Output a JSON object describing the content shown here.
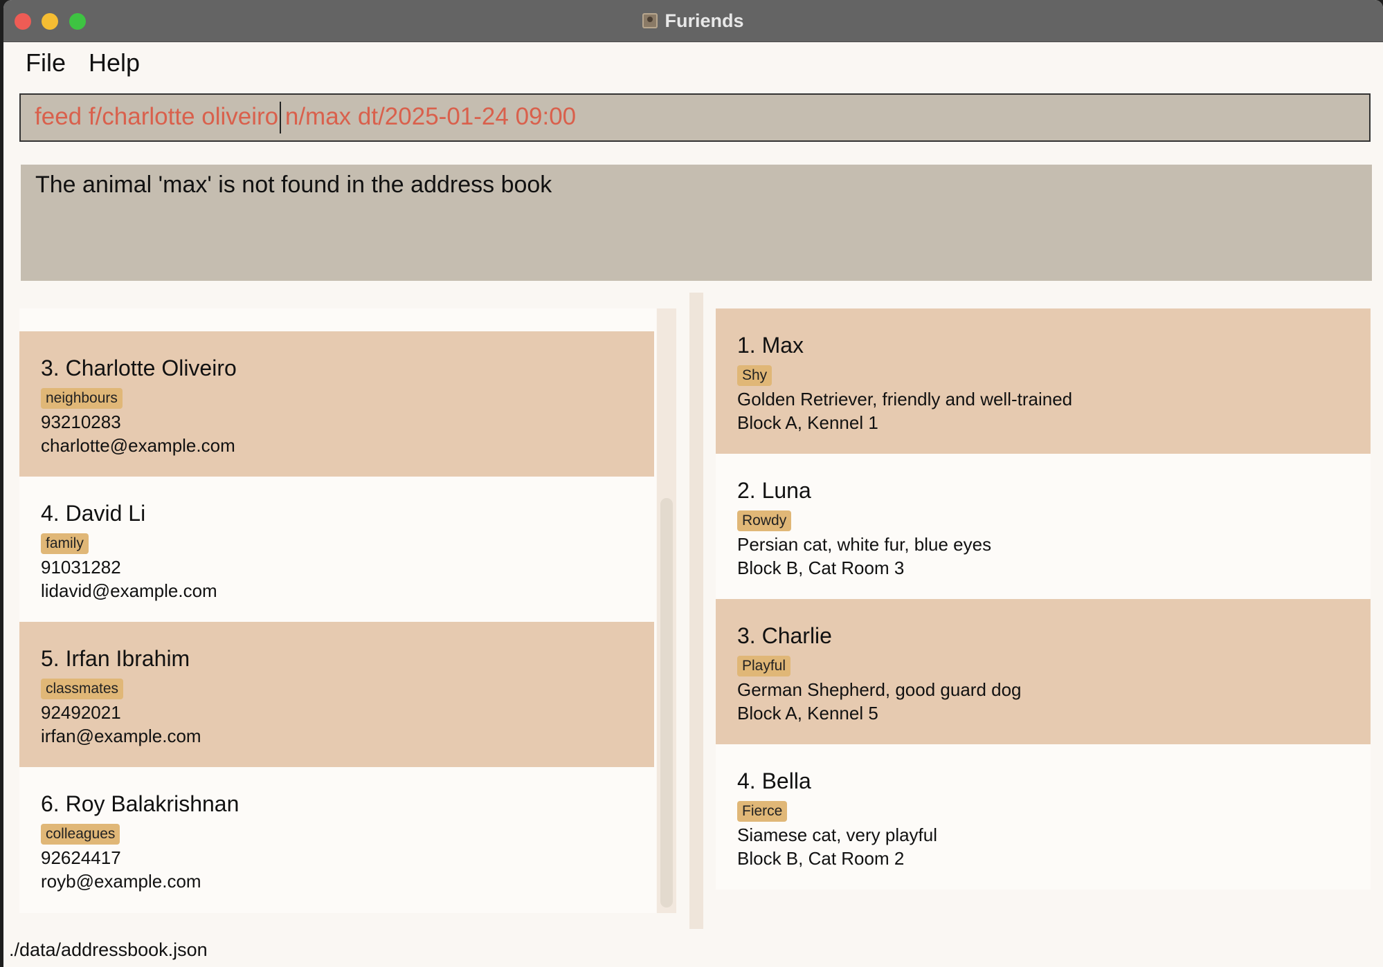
{
  "window": {
    "title": "Furiends"
  },
  "menu": {
    "file": "File",
    "help": "Help"
  },
  "command": {
    "value": "feed f/charlotte oliveiro n/max dt/2025-01-24 09:00"
  },
  "result": {
    "message": "The animal 'max' is not found in the address book"
  },
  "persons": [
    {
      "name": "3. Charlotte Oliveiro",
      "tag": "neighbours",
      "phone": "93210283",
      "email": "charlotte@example.com"
    },
    {
      "name": "4. David Li",
      "tag": "family",
      "phone": "91031282",
      "email": "lidavid@example.com"
    },
    {
      "name": "5. Irfan Ibrahim",
      "tag": "classmates",
      "phone": "92492021",
      "email": "irfan@example.com"
    },
    {
      "name": "6. Roy Balakrishnan",
      "tag": "colleagues",
      "phone": "92624417",
      "email": "royb@example.com"
    }
  ],
  "animals": [
    {
      "name": "1. Max",
      "tag": "Shy",
      "description": "Golden Retriever, friendly and well-trained",
      "location": "Block A, Kennel 1"
    },
    {
      "name": "2. Luna",
      "tag": "Rowdy",
      "description": "Persian cat, white fur, blue eyes",
      "location": "Block B, Cat Room 3"
    },
    {
      "name": "3. Charlie",
      "tag": "Playful",
      "description": "German Shepherd, good guard dog",
      "location": "Block A, Kennel 5"
    },
    {
      "name": "4. Bella",
      "tag": "Fierce",
      "description": "Siamese cat, very playful",
      "location": "Block B, Cat Room 2"
    }
  ],
  "status": {
    "path": "./data/addressbook.json"
  },
  "colors": {
    "titlebar": "#646464",
    "card_shaded": "#e6cab0",
    "card_plain": "#fdfbf8",
    "tag": "#e0b777",
    "command_text": "#d9604c",
    "box_bg": "#c5bdb0"
  }
}
